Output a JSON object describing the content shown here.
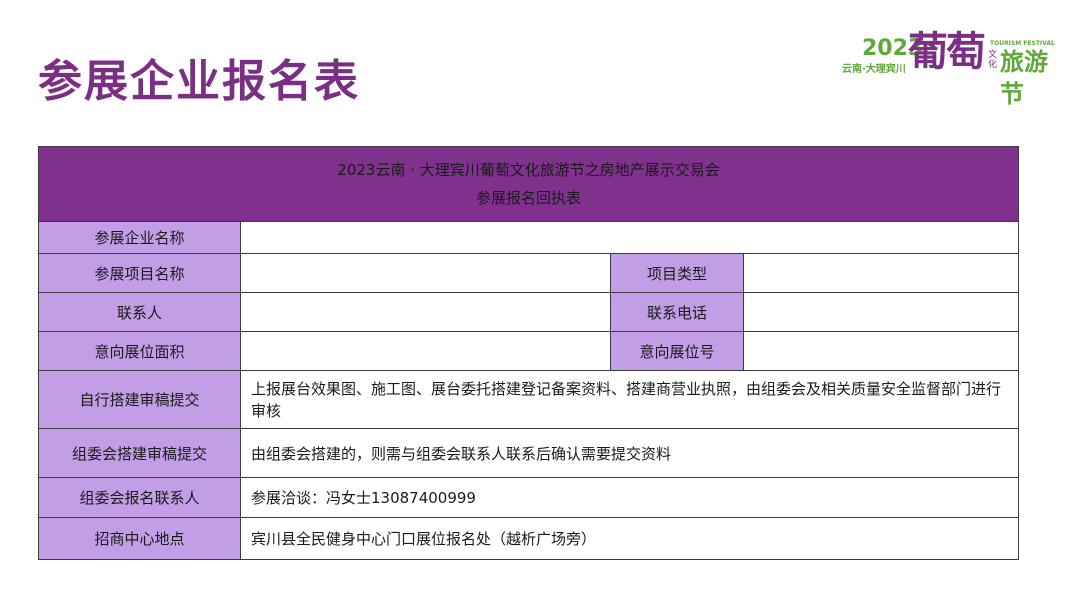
{
  "title": "参展企业报名表",
  "logo": {
    "year": "2023",
    "subtitle": "云南·大理宾川",
    "glyph1": "葡",
    "glyph2": "萄",
    "small_en": "TOURISM FESTIVAL",
    "small_cn": "文化",
    "tail": "旅游节"
  },
  "form": {
    "header_line1": "2023云南 · 大理宾川葡萄文化旅游节之房地产展示交易会",
    "header_line2": "参展报名回执表",
    "rows": {
      "company_name": {
        "label": "参展企业名称",
        "value": ""
      },
      "project_name": {
        "label": "参展项目名称",
        "value": ""
      },
      "project_type": {
        "label": "项目类型",
        "value": ""
      },
      "contact": {
        "label": "联系人",
        "value": ""
      },
      "contact_phone": {
        "label": "联系电话",
        "value": ""
      },
      "booth_area": {
        "label": "意向展位面积",
        "value": ""
      },
      "booth_number": {
        "label": "意向展位号",
        "value": ""
      },
      "self_build": {
        "label": "自行搭建审稿提交",
        "value": "上报展台效果图、施工图、展台委托搭建登记备案资料、搭建商营业执照，由组委会及相关质量安全监督部门进行审核"
      },
      "committee_build": {
        "label": "组委会搭建审稿提交",
        "value": "由组委会搭建的，则需与组委会联系人联系后确认需要提交资料"
      },
      "committee_contact": {
        "label": "组委会报名联系人",
        "value": "参展洽谈：冯女士13087400999"
      },
      "investment_center": {
        "label": "招商中心地点",
        "value": "宾川县全民健身中心门口展位报名处（越析广场旁）"
      }
    }
  }
}
